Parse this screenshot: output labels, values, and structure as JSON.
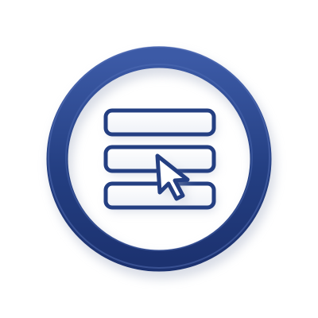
{
  "icon": {
    "name": "menu-selection-icon",
    "description_visible_text": ""
  },
  "colors": {
    "background": "#ffffff",
    "ring": "#243f82",
    "ring_highlight": "#3c5aa6",
    "bar_outline": "#243f82",
    "bar_fill": "#ffffff",
    "cursor_outline": "#243f82",
    "cursor_fill": "#ffffff",
    "shadow": "#c9cfdc"
  },
  "menu": {
    "item_count": 3,
    "selected_item_index": 1
  }
}
